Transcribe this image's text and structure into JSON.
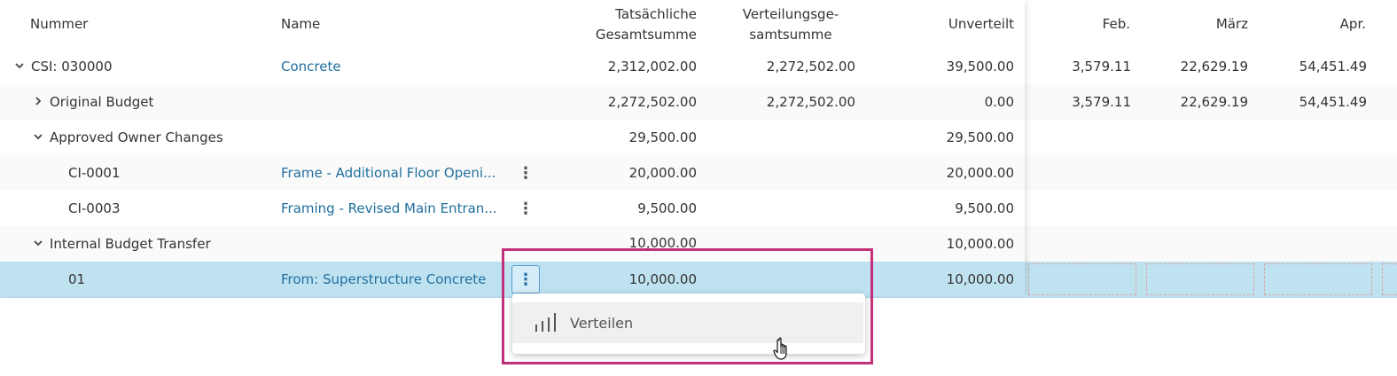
{
  "header": {
    "nummer": "Nummer",
    "name": "Name",
    "tatsaechliche_line1": "Tatsächliche",
    "tatsaechliche_line2": "Gesamtsumme",
    "verteilung_line1": "Verteilungsge-",
    "verteilung_line2": "samtsumme",
    "unverteilt": "Unverteilt",
    "feb": "Feb.",
    "maerz": "März",
    "apr": "Apr."
  },
  "rows": [
    {
      "nummer": "CSI: 030000",
      "name": "Concrete",
      "actual": "2,312,002.00",
      "dist": "2,272,502.00",
      "unverteilt": "39,500.00",
      "feb": "3,579.11",
      "maerz": "22,629.19",
      "apr": "54,451.49"
    },
    {
      "nummer": "Original Budget",
      "name": "",
      "actual": "2,272,502.00",
      "dist": "2,272,502.00",
      "unverteilt": "0.00",
      "feb": "3,579.11",
      "maerz": "22,629.19",
      "apr": "54,451.49"
    },
    {
      "nummer": "Approved Owner Changes",
      "name": "",
      "actual": "29,500.00",
      "dist": "",
      "unverteilt": "29,500.00"
    },
    {
      "nummer": "CI-0001",
      "name": "Frame - Additional Floor Openi...",
      "actual": "20,000.00",
      "dist": "",
      "unverteilt": "20,000.00"
    },
    {
      "nummer": "CI-0003",
      "name": "Framing - Revised Main Entran...",
      "actual": "9,500.00",
      "dist": "",
      "unverteilt": "9,500.00"
    },
    {
      "nummer": "Internal Budget Transfer",
      "name": "",
      "actual": "10,000.00",
      "dist": "",
      "unverteilt": "10,000.00"
    },
    {
      "nummer": "01",
      "name": "From: Superstructure Concrete",
      "actual": "10,000.00",
      "dist": "",
      "unverteilt": "10,000.00"
    }
  ],
  "icons": {
    "expanded": "chevron-down-icon",
    "collapsed": "chevron-right-icon",
    "more": "more-vertical-icon",
    "distribute": "bar-chart-icon",
    "cursor": "hand-pointer-icon"
  },
  "menu": {
    "distribute_label": "Verteilen"
  },
  "colors": {
    "link": "#1f6f9e",
    "selected_row": "#bfe2f1",
    "highlight_border": "#c2317a"
  }
}
